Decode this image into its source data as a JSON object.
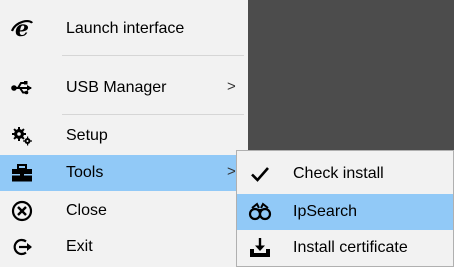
{
  "colors": {
    "menu_background": "#f2f2f2",
    "highlight": "#91c9f7",
    "backdrop": "#4c4c4c",
    "separator": "#d6d6d6"
  },
  "menu": {
    "items": [
      {
        "label": "Launch interface",
        "icon": "internet-explorer-icon",
        "has_submenu": false
      },
      {
        "label": "USB Manager",
        "icon": "usb-icon",
        "has_submenu": true,
        "arrow": ">"
      },
      {
        "label": "Setup",
        "icon": "gears-icon",
        "has_submenu": false
      },
      {
        "label": "Tools",
        "icon": "toolbox-icon",
        "has_submenu": true,
        "arrow": ">",
        "highlighted": true
      },
      {
        "label": "Close",
        "icon": "close-circle-icon",
        "has_submenu": false
      },
      {
        "label": "Exit",
        "icon": "exit-arrow-icon",
        "has_submenu": false
      }
    ]
  },
  "submenu": {
    "items": [
      {
        "label": "Check install",
        "icon": "checkmark-icon"
      },
      {
        "label": "IpSearch",
        "icon": "binoculars-icon",
        "highlighted": true
      },
      {
        "label": "Install certificate",
        "icon": "install-download-icon"
      }
    ]
  }
}
